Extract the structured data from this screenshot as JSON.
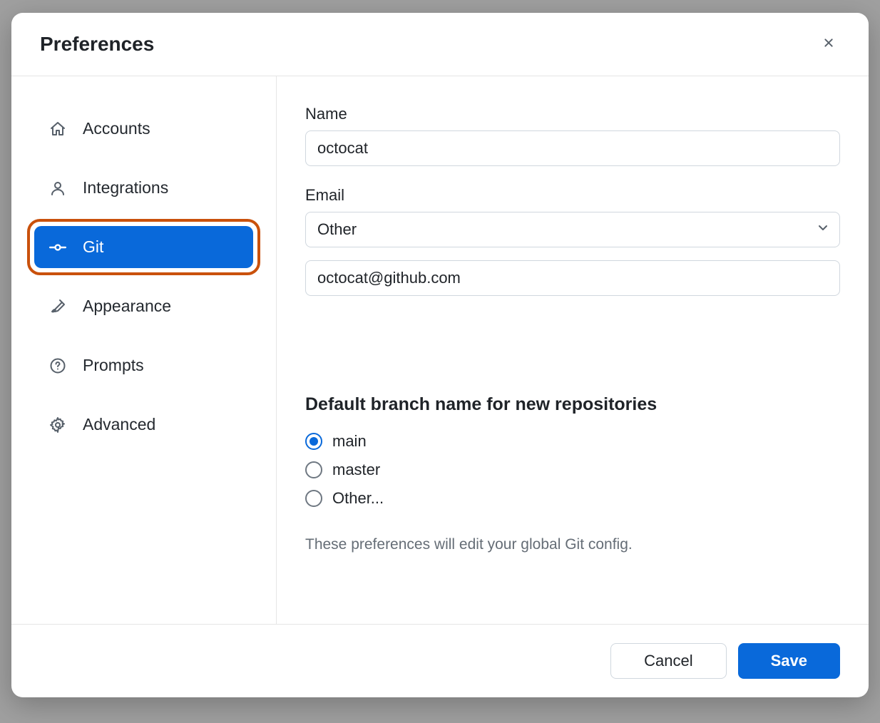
{
  "dialog": {
    "title": "Preferences"
  },
  "sidebar": {
    "items": [
      {
        "label": "Accounts",
        "icon": "home-icon",
        "active": false
      },
      {
        "label": "Integrations",
        "icon": "person-icon",
        "active": false
      },
      {
        "label": "Git",
        "icon": "git-commit-icon",
        "active": true,
        "highlight": true
      },
      {
        "label": "Appearance",
        "icon": "paintbrush-icon",
        "active": false
      },
      {
        "label": "Prompts",
        "icon": "question-circle-icon",
        "active": false
      },
      {
        "label": "Advanced",
        "icon": "gear-icon",
        "active": false
      }
    ]
  },
  "git": {
    "name_label": "Name",
    "name_value": "octocat",
    "email_label": "Email",
    "email_select_value": "Other",
    "email_value": "octocat@github.com",
    "default_branch_heading": "Default branch name for new repositories",
    "branch_options": [
      {
        "label": "main",
        "checked": true
      },
      {
        "label": "master",
        "checked": false
      },
      {
        "label": "Other...",
        "checked": false
      }
    ],
    "helper": "These preferences will edit your global Git config."
  },
  "footer": {
    "cancel": "Cancel",
    "save": "Save"
  }
}
